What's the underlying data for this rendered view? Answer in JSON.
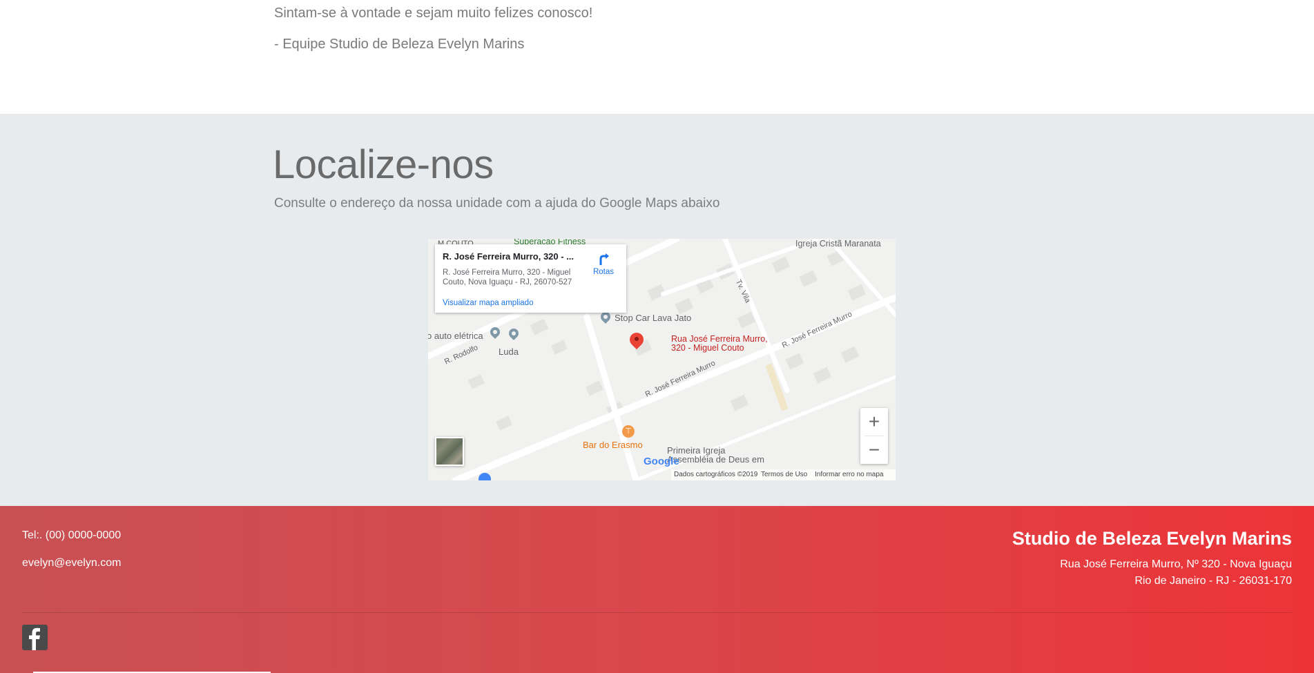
{
  "intro": {
    "line1": "Sintam-se à vontade e sejam muito felizes conosco!",
    "line2": "- Equipe Studio de Beleza Evelyn Marins"
  },
  "locate": {
    "title": "Localize-nos",
    "subtitle": "Consulte o endereço da nossa unidade com a ajuda do Google Maps abaixo"
  },
  "map": {
    "info_title": "R. José Ferreira Murro, 320 - ...",
    "info_address": "R. José Ferreira Murro, 320 - Miguel Couto, Nova Iguaçu - RJ, 26070-527",
    "directions_label": "Rotas",
    "larger_map_link": "Visualizar mapa ampliado",
    "marker_label_1": "Rua José Ferreira Murro,",
    "marker_label_2": "320 - Miguel Couto",
    "places": {
      "fitness": "Superação Fitness",
      "couto": "M COUTO",
      "church1": "Igreja Cristã Maranata",
      "stopcar": "Stop Car Lava Jato",
      "auto": "o auto elétrica",
      "luda": "Luda",
      "rodolfo": "R. Rodolfo",
      "street1": "R. José Ferreira Murro",
      "street2": "R. José Ferreira Murro",
      "tvvila": "Tv. Vila",
      "bar": "Bar do Erasmo",
      "church2a": "Primeira Igreja",
      "church2b": "Assembléia de Deus em"
    },
    "zoom_in": "+",
    "zoom_out": "−",
    "logo": "Google",
    "footer_data": "Dados cartográficos ©2019",
    "footer_terms": "Termos de Uso",
    "footer_report": "Informar erro no mapa",
    "colors": {
      "marker": "#ea4335",
      "link": "#1a73e8",
      "food": "#f29a4a"
    }
  },
  "footer": {
    "tel": "Tel:. (00) 0000-0000",
    "email": "evelyn@evelyn.com",
    "brand": "Studio de Beleza Evelyn Marins",
    "address_line1": "Rua José Ferreira Murro, Nº 320 - Nova Iguaçu",
    "address_line2": "Rio de Janeiro - RJ - 26031-170",
    "social_icon": "facebook-icon",
    "colors": {
      "gradient_start": "#c85053",
      "gradient_end": "#ec3438"
    }
  }
}
